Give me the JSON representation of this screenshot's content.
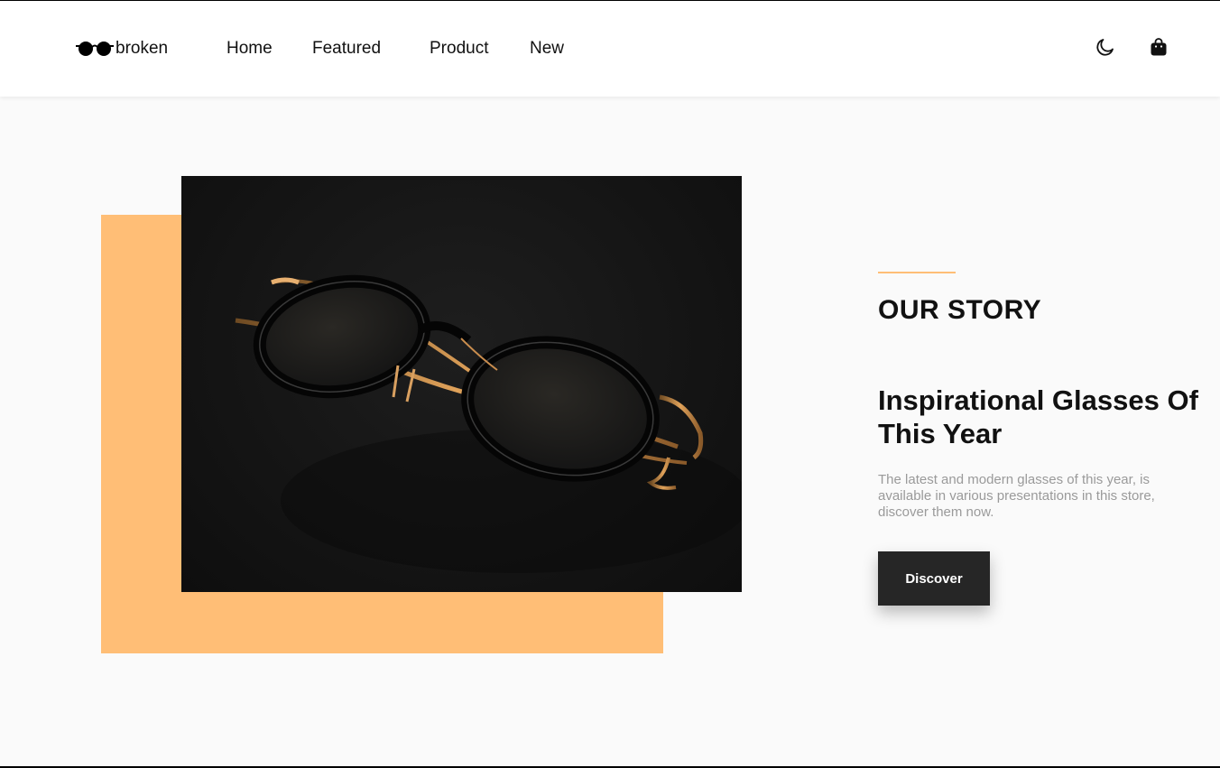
{
  "header": {
    "logo_text": "broken",
    "nav": [
      {
        "label": "Home"
      },
      {
        "label": "Featured"
      },
      {
        "label": "Product"
      },
      {
        "label": "New"
      }
    ],
    "icons": [
      "glasses-logo-icon",
      "moon-icon",
      "shopping-bag-icon"
    ]
  },
  "story": {
    "section_title": "OUR STORY",
    "headline": "Inspirational Glasses Of This Year",
    "description": "The latest and modern glasses of this year, is available in various presentations in this store, discover them now.",
    "button_label": "Discover"
  },
  "colors": {
    "accent": "#ffbe76",
    "background": "#fafafa",
    "button": "#262626",
    "text": "#111111",
    "muted_text": "#9a9a9a"
  }
}
